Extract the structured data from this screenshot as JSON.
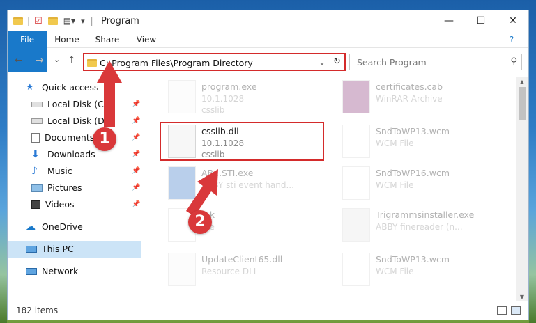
{
  "window": {
    "title": "Program",
    "minimize": "—",
    "maximize": "☐",
    "close": "✕"
  },
  "ribbon": {
    "tabs": [
      "File",
      "Home",
      "Share",
      "View"
    ],
    "help": "?"
  },
  "nav": {
    "back": "←",
    "forward": "→",
    "recent": "⌄",
    "up": "↑",
    "address": "C:\\Program Files\\Program Directory",
    "search_placeholder": "Search Program"
  },
  "sidebar": {
    "items": [
      {
        "label": "Quick access",
        "icon": "star-icon",
        "pinned": false
      },
      {
        "label": "Local Disk (C:)",
        "icon": "drive-icon",
        "pinned": true
      },
      {
        "label": "Local Disk (D:)",
        "icon": "drive-icon",
        "pinned": true
      },
      {
        "label": "Documents",
        "icon": "documents-icon",
        "pinned": true
      },
      {
        "label": "Downloads",
        "icon": "downloads-icon",
        "pinned": true
      },
      {
        "label": "Music",
        "icon": "music-icon",
        "pinned": true
      },
      {
        "label": "Pictures",
        "icon": "pictures-icon",
        "pinned": true
      },
      {
        "label": "Videos",
        "icon": "videos-icon",
        "pinned": true
      },
      {
        "label": "OneDrive",
        "icon": "cloud-icon",
        "pinned": false
      },
      {
        "label": "This PC",
        "icon": "computer-icon",
        "pinned": false,
        "selected": true
      },
      {
        "label": "Network",
        "icon": "network-icon",
        "pinned": false
      }
    ]
  },
  "files": [
    {
      "name": "program.exe",
      "l2": "10.1.1028",
      "l3": "csslib",
      "faded": true
    },
    {
      "name": "certificates.cab",
      "l2": "WinRAR Archive",
      "l3": "",
      "faded": true
    },
    {
      "name": "csslib.dll",
      "l2": "10.1.1028",
      "l3": "csslib",
      "faded": false
    },
    {
      "name": "SndToWP13.wcm",
      "l2": "WCM File",
      "l3": "",
      "faded": true
    },
    {
      "name": "AB...STI.exe",
      "l2": "ABBY sti event hand...",
      "l3": "",
      "faded": true
    },
    {
      "name": "SndToWP16.wcm",
      "l2": "WCM File",
      "l3": "",
      "faded": true
    },
    {
      "name": "...k",
      "l2": "...e",
      "l3": "",
      "faded": true
    },
    {
      "name": "Trigrammsinstaller.exe",
      "l2": "ABBY finereader (n...",
      "l3": "",
      "faded": true
    },
    {
      "name": "UpdateClient65.dll",
      "l2": "Resource DLL",
      "l3": "",
      "faded": true
    },
    {
      "name": "SndToWP13.wcm",
      "l2": "WCM File",
      "l3": "",
      "faded": true
    }
  ],
  "status": {
    "count": "182 items"
  },
  "annotations": {
    "step1": "1",
    "step2": "2",
    "color": "#d9383a"
  }
}
